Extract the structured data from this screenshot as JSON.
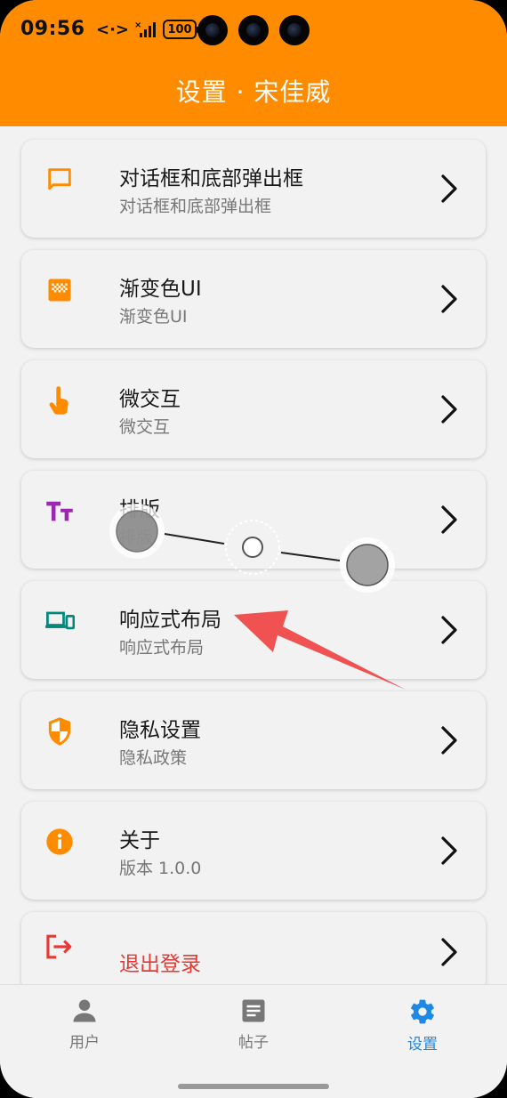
{
  "status_bar": {
    "time": "09:56",
    "data_icon": "<·>",
    "battery": "100"
  },
  "header": {
    "title": "设置 · 宋佳威"
  },
  "colors": {
    "brand": "#ff8c00",
    "active_tab": "#1e88e5",
    "logout": "#e53935",
    "gradient_icon": "#ff8c00",
    "typography_icon": "#9c27b0",
    "responsive_icon": "#00897b"
  },
  "menu": [
    {
      "icon": "chat-bubble-icon",
      "title": "对话框和底部弹出框",
      "subtitle": "对话框和底部弹出框"
    },
    {
      "icon": "gradient-icon",
      "title": "渐变色UI",
      "subtitle": "渐变色UI"
    },
    {
      "icon": "touch-icon",
      "title": "微交互",
      "subtitle": "微交互"
    },
    {
      "icon": "text-fields-icon",
      "title": "排版",
      "subtitle": "排版"
    },
    {
      "icon": "devices-icon",
      "title": "响应式布局",
      "subtitle": "响应式布局"
    },
    {
      "icon": "shield-icon",
      "title": "隐私设置",
      "subtitle": "隐私政策"
    },
    {
      "icon": "info-icon",
      "title": "关于",
      "subtitle": "版本 1.0.0"
    },
    {
      "icon": "logout-icon",
      "title": "退出登录"
    }
  ],
  "bottom_nav": {
    "items": [
      {
        "icon": "person-icon",
        "label": "用户"
      },
      {
        "icon": "article-icon",
        "label": "帖子"
      },
      {
        "icon": "gear-icon",
        "label": "设置",
        "active": true
      }
    ]
  }
}
